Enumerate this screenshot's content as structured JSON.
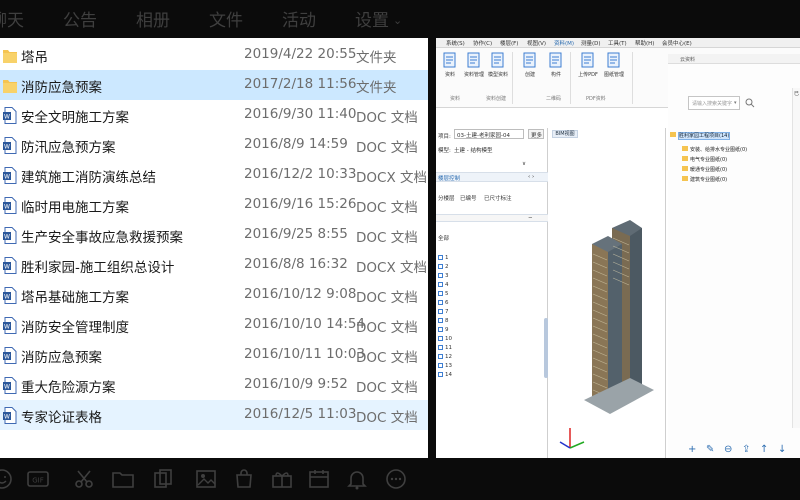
{
  "top_tabs": [
    {
      "label": "聊天"
    },
    {
      "label": "公告"
    },
    {
      "label": "相册"
    },
    {
      "label": "文件"
    },
    {
      "label": "活动"
    },
    {
      "label": "设置"
    }
  ],
  "files": [
    {
      "name": "塔吊",
      "date": "2019/4/22 20:55",
      "type": "文件夹",
      "icon": "folder-icon",
      "state": "normal"
    },
    {
      "name": "消防应急预案",
      "date": "2017/2/18 11:56",
      "type": "文件夹",
      "icon": "folder-icon",
      "state": "selected"
    },
    {
      "name": "安全文明施工方案",
      "date": "2016/9/30 11:40",
      "type": "DOC 文档",
      "icon": "word-doc-icon",
      "state": "normal"
    },
    {
      "name": "防汛应急预方案",
      "date": "2016/8/9 14:59",
      "type": "DOC 文档",
      "icon": "word-doc-icon",
      "state": "normal"
    },
    {
      "name": "建筑施工消防演练总结",
      "date": "2016/12/2 10:33",
      "type": "DOCX 文档",
      "icon": "word-doc-icon",
      "state": "normal"
    },
    {
      "name": "临时用电施工方案",
      "date": "2016/9/16 15:26",
      "type": "DOC 文档",
      "icon": "word-doc-icon",
      "state": "normal"
    },
    {
      "name": "生产安全事故应急救援预案",
      "date": "2016/9/25 8:55",
      "type": "DOC 文档",
      "icon": "word-doc-icon",
      "state": "normal"
    },
    {
      "name": "胜利家园-施工组织总设计",
      "date": "2016/8/8 16:32",
      "type": "DOCX 文档",
      "icon": "word-doc-icon",
      "state": "normal"
    },
    {
      "name": "塔吊基础施工方案",
      "date": "2016/10/12 9:08",
      "type": "DOC 文档",
      "icon": "word-doc-icon",
      "state": "normal"
    },
    {
      "name": "消防安全管理制度",
      "date": "2016/10/10 14:54",
      "type": "DOC 文档",
      "icon": "word-doc-icon",
      "state": "normal"
    },
    {
      "name": "消防应急预案",
      "date": "2016/10/11 10:03",
      "type": "DOC 文档",
      "icon": "word-doc-icon",
      "state": "normal"
    },
    {
      "name": "重大危险源方案",
      "date": "2016/10/9 9:52",
      "type": "DOC 文档",
      "icon": "word-doc-icon",
      "state": "normal"
    },
    {
      "name": "专家论证表格",
      "date": "2016/12/5 11:03",
      "type": "DOC 文档",
      "icon": "word-doc-icon",
      "state": "hover"
    }
  ],
  "app": {
    "menu": [
      "系统(S)",
      "协作(C)",
      "楼层(F)",
      "视图(V)",
      "资料(M)",
      "测量(D)",
      "工具(T)",
      "帮助(H)",
      "会员中心(E)"
    ],
    "active_menu": "资料(M)",
    "ribbon_buttons": [
      "资料",
      "资料管理",
      "模型资料",
      "创建",
      "构件",
      "上传PDF",
      "图纸管理"
    ],
    "ribbon_groups": [
      "资料",
      "资料创建",
      "二维码",
      "PDF资料"
    ],
    "project_label": "项目:",
    "project_value": "03-土建-老利家园-04",
    "project_btn": "更多",
    "model_label": "模型:",
    "model_value": "土建 - 结构模型",
    "floor_label": "楼层控制",
    "filter_opts": [
      "分楼层",
      "已编号",
      "已尺寸标注"
    ],
    "floor_all": "全部",
    "floors": [
      "1",
      "2",
      "3",
      "4",
      "5",
      "6",
      "7",
      "8",
      "9",
      "10",
      "11",
      "12",
      "13",
      "14"
    ],
    "view_tab": "BIM视图",
    "right_header": "云资料",
    "search_placeholder": "请输入搜索关键字",
    "right_col_label": "已",
    "tree": [
      {
        "label": "胜利家园工程项目(14)",
        "selected": true
      },
      {
        "label": "安装、给排水专业图纸(0)"
      },
      {
        "label": "电气专业图纸(0)"
      },
      {
        "label": "暖通专业图纸(0)"
      },
      {
        "label": "建筑专业图纸(0)"
      }
    ],
    "bottom_actions": [
      "+",
      "✎",
      "⊖",
      "⇪",
      "↑",
      "↓"
    ]
  },
  "bottom_icons": [
    "emoji-icon",
    "gif-icon",
    "scissors-icon",
    "folder-icon",
    "copy-icon",
    "image-icon",
    "bag-icon",
    "gift-icon",
    "calendar-icon",
    "bell-icon",
    "more-icon"
  ],
  "colors": {
    "selected_row": "#cce8ff",
    "hover_row": "#e5f3ff",
    "folder_yellow": "#f5c451",
    "word_blue": "#2b579a",
    "dark_bg": "#0b0b0b",
    "dark_text": "#3f3f3f"
  }
}
